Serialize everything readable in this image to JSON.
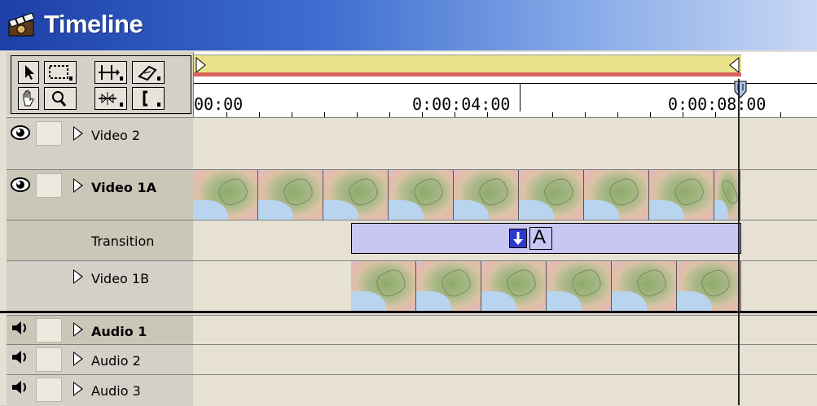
{
  "window": {
    "title": "Timeline"
  },
  "tools": [
    {
      "name": "selection-tool-icon"
    },
    {
      "name": "range-select-tool-icon"
    },
    {
      "name": "track-select-tool-icon"
    },
    {
      "name": "razor-tool-icon"
    },
    {
      "name": "hand-tool-icon"
    },
    {
      "name": "zoom-tool-icon"
    },
    {
      "name": "ripple-edit-tool-icon"
    },
    {
      "name": "in-out-point-tool-icon"
    }
  ],
  "ruler": {
    "labels": [
      "00:00",
      "0:00:04:00",
      "0:00:08:00"
    ]
  },
  "tracks": {
    "video2": {
      "label": "Video 2"
    },
    "video1a": {
      "label": "Video 1A"
    },
    "transition": {
      "label": "Transition",
      "icon_letter": "A"
    },
    "video1b": {
      "label": "Video 1B"
    },
    "audio1": {
      "label": "Audio 1"
    },
    "audio2": {
      "label": "Audio 2"
    },
    "audio3": {
      "label": "Audio 3"
    }
  },
  "colors": {
    "title_gradient_start": "#1d3fa6",
    "work_area": "#e8e28a",
    "work_area_line": "#d9625a",
    "transition_fill": "#c9c6f3",
    "track_bg": "#e6e1d3"
  }
}
